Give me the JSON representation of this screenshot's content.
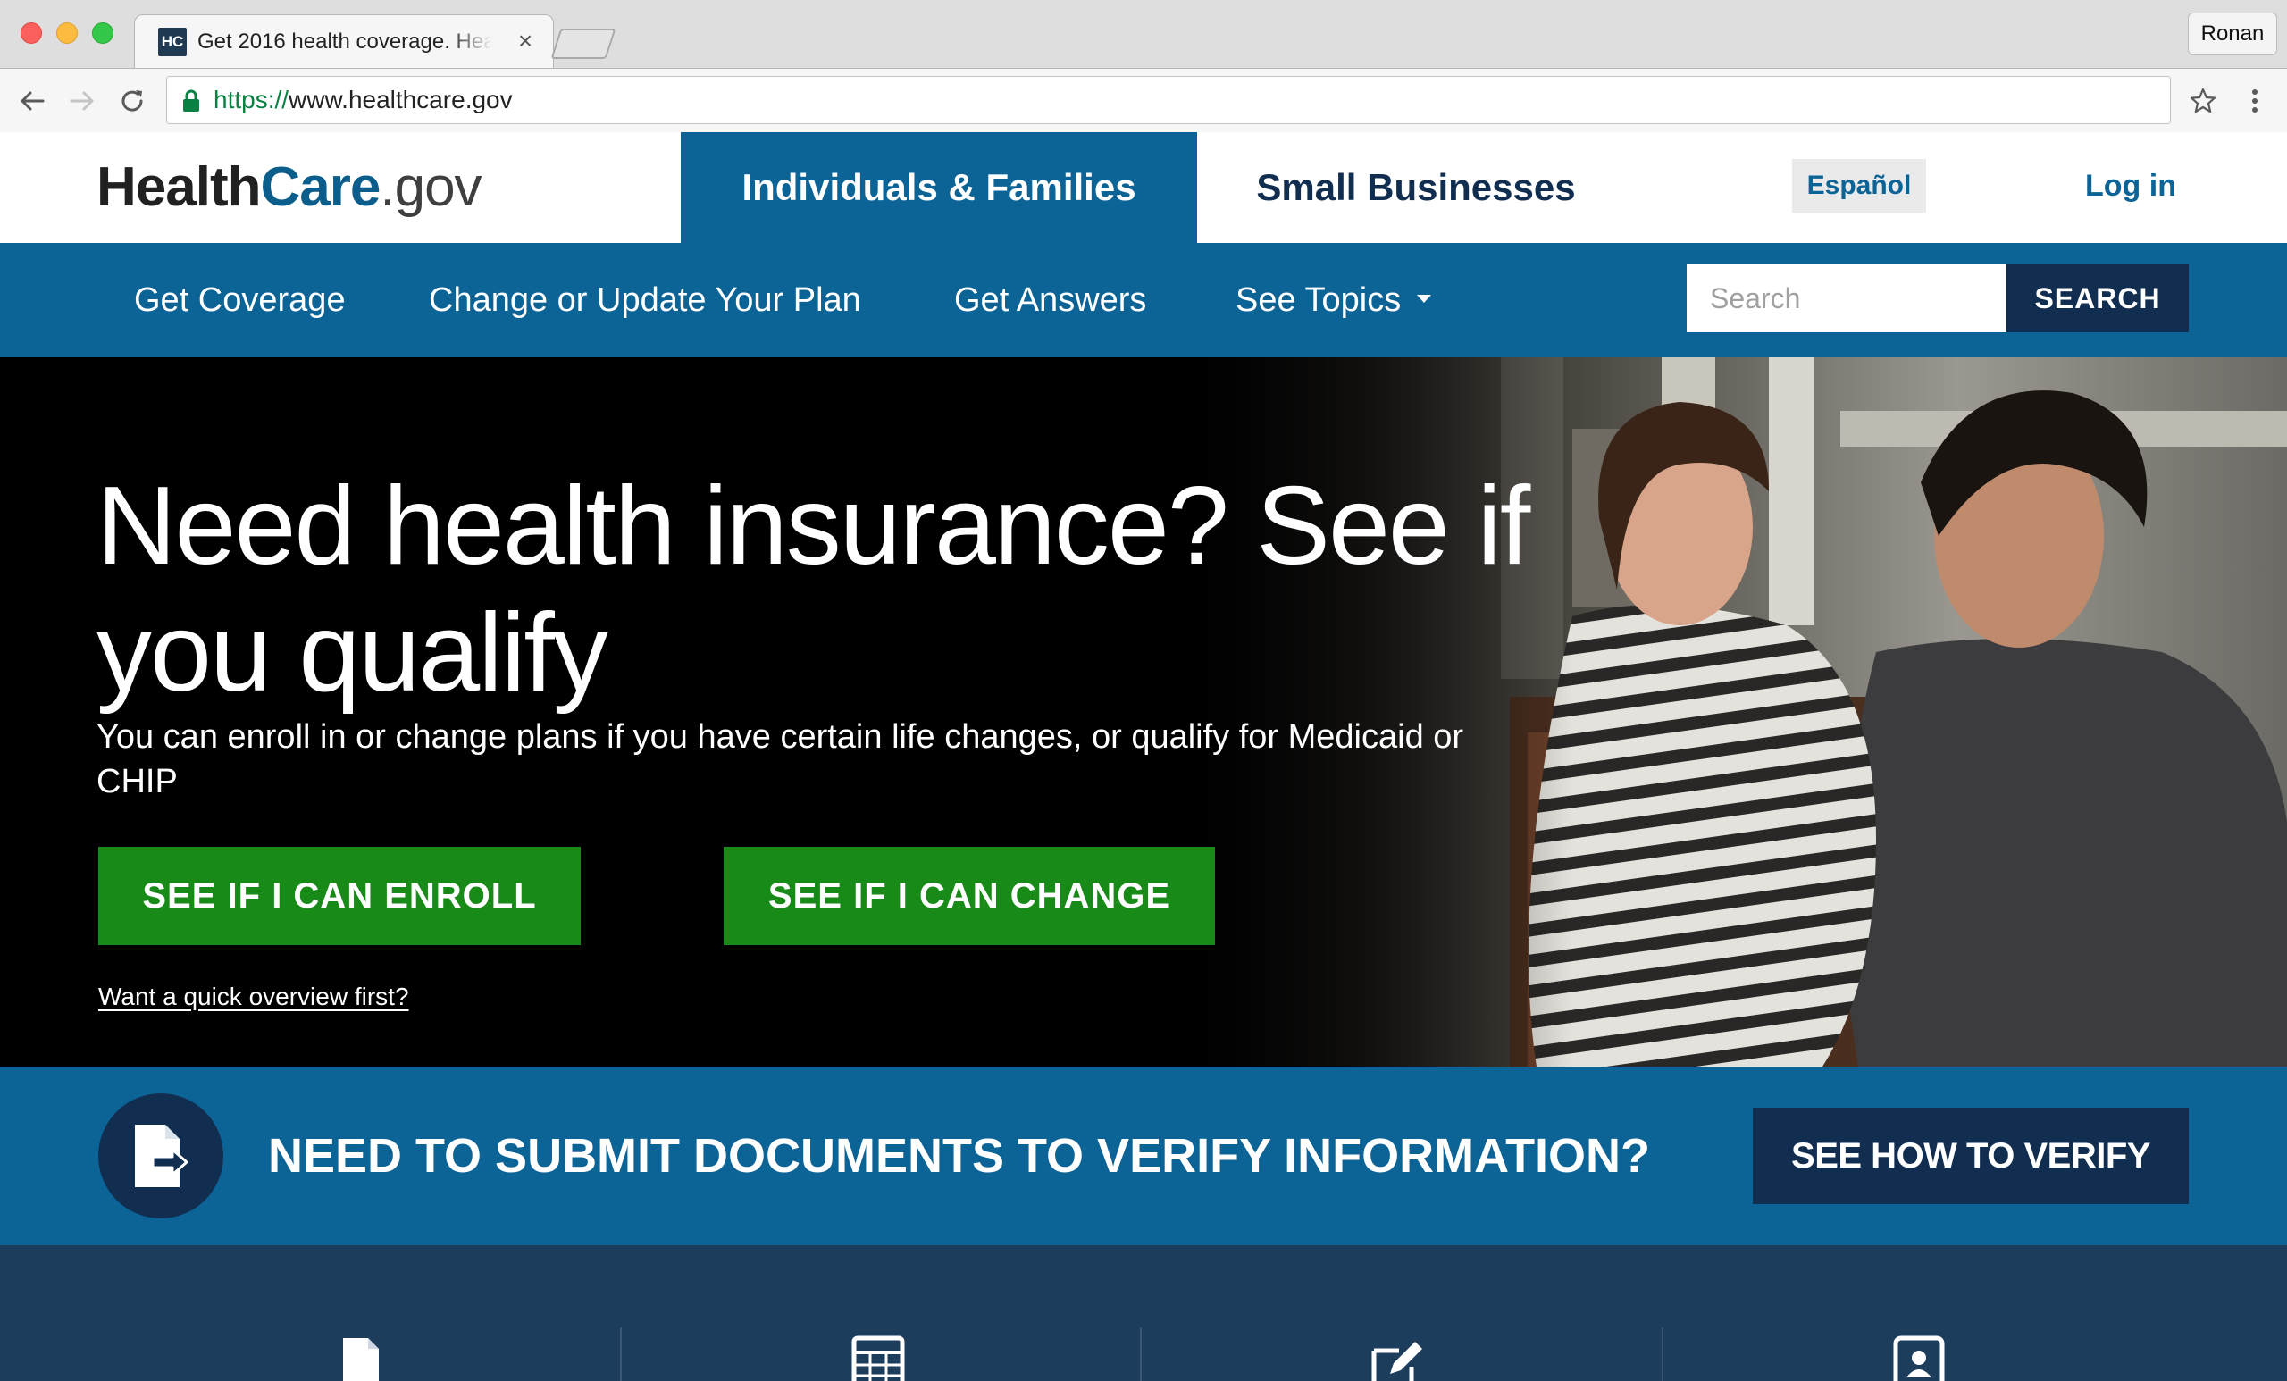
{
  "browser": {
    "tab_title": "Get 2016 health coverage. Health",
    "tab_favicon_text": "HC",
    "tab_close": "×",
    "profile_name": "Ronan",
    "url_scheme": "https://",
    "url_rest": "www.healthcare.gov"
  },
  "header": {
    "logo_health": "Health",
    "logo_care": "Care",
    "logo_gov": ".gov",
    "tab_individuals": "Individuals & Families",
    "tab_business": "Small Businesses",
    "espanol": "Español",
    "login": "Log in"
  },
  "subnav": {
    "items": [
      "Get Coverage",
      "Change or Update Your Plan",
      "Get Answers",
      "See Topics"
    ],
    "search_placeholder": "Search",
    "search_button": "SEARCH"
  },
  "hero": {
    "title": "Need health insurance? See if you qualify",
    "subtitle": "You can enroll in or change plans if you have certain life changes, or qualify for Medicaid or CHIP",
    "enroll_button": "SEE IF I CAN ENROLL",
    "change_button": "SEE IF I CAN CHANGE",
    "overview_link": "Want a quick overview first?"
  },
  "verify": {
    "text": "NEED TO SUBMIT DOCUMENTS TO VERIFY INFORMATION?",
    "button": "SEE HOW TO VERIFY"
  },
  "tools": {
    "icons": [
      "document-icon",
      "calculator-icon",
      "edit-icon",
      "contact-card-icon"
    ]
  },
  "colors": {
    "primary_blue": "#0b6396",
    "dark_navy": "#112e51",
    "action_green": "#178a17",
    "tools_bg": "#1d3d5c"
  }
}
